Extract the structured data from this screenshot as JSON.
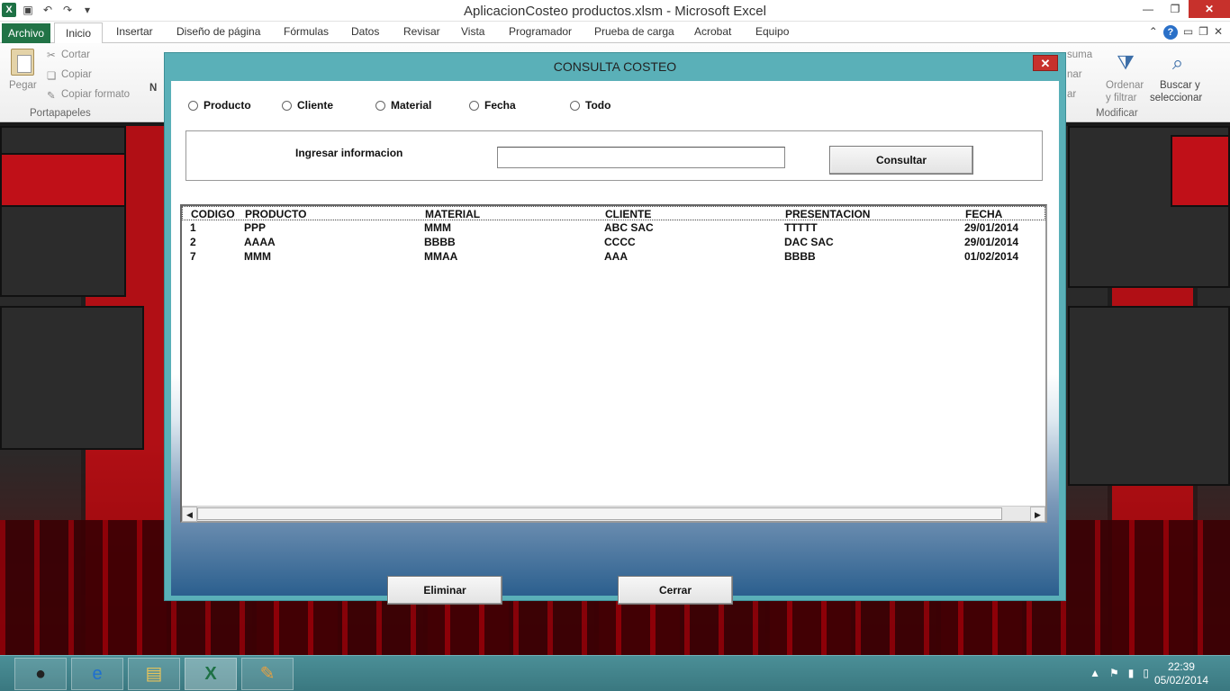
{
  "window": {
    "title": "AplicacionCosteo productos.xlsm  -  Microsoft Excel",
    "logo_letter": "X"
  },
  "ribbon": {
    "tabs": [
      "Archivo",
      "Inicio",
      "Insertar",
      "Diseño de página",
      "Fórmulas",
      "Datos",
      "Revisar",
      "Vista",
      "Programador",
      "Prueba de carga",
      "Acrobat",
      "Equipo"
    ],
    "active_tab": "Inicio",
    "clipboard": {
      "paste": "Pegar",
      "cut": "Cortar",
      "copy": "Copiar",
      "copy_format": "Copiar formato",
      "group": "Portapapeles"
    },
    "editing": {
      "sum": "suma",
      "fill": "nar",
      "clear": "ar",
      "sort_filter_1": "Ordenar",
      "sort_filter_2": "y filtrar",
      "find_1": "Buscar y",
      "find_2": "seleccionar",
      "group": "Modificar"
    },
    "font_n": "N",
    "help": "?"
  },
  "dialog": {
    "title": "CONSULTA COSTEO",
    "close": "✕",
    "radios": [
      "Producto",
      "Cliente",
      "Material",
      "Fecha",
      "Todo"
    ],
    "search_label": "Ingresar informacion",
    "search_value": "",
    "consultar": "Consultar",
    "columns": [
      "CODIGO",
      "PRODUCTO",
      "MATERIAL",
      "CLIENTE",
      "PRESENTACION",
      "FECHA"
    ],
    "rows": [
      [
        "1",
        "PPP",
        "MMM",
        "ABC SAC",
        "TTTTT",
        "29/01/2014"
      ],
      [
        "2",
        "AAAA",
        "BBBB",
        "CCCC",
        "DAC SAC",
        "29/01/2014"
      ],
      [
        "7",
        "MMM",
        "MMAA",
        "AAA",
        "BBBB",
        "01/02/2014"
      ]
    ],
    "eliminar": "Eliminar",
    "cerrar": "Cerrar"
  },
  "taskbar": {
    "apps": [
      "firefox-icon",
      "ie-icon",
      "explorer-icon",
      "excel-icon",
      "paint-icon"
    ],
    "time": "22:39",
    "date": "05/02/2014"
  }
}
